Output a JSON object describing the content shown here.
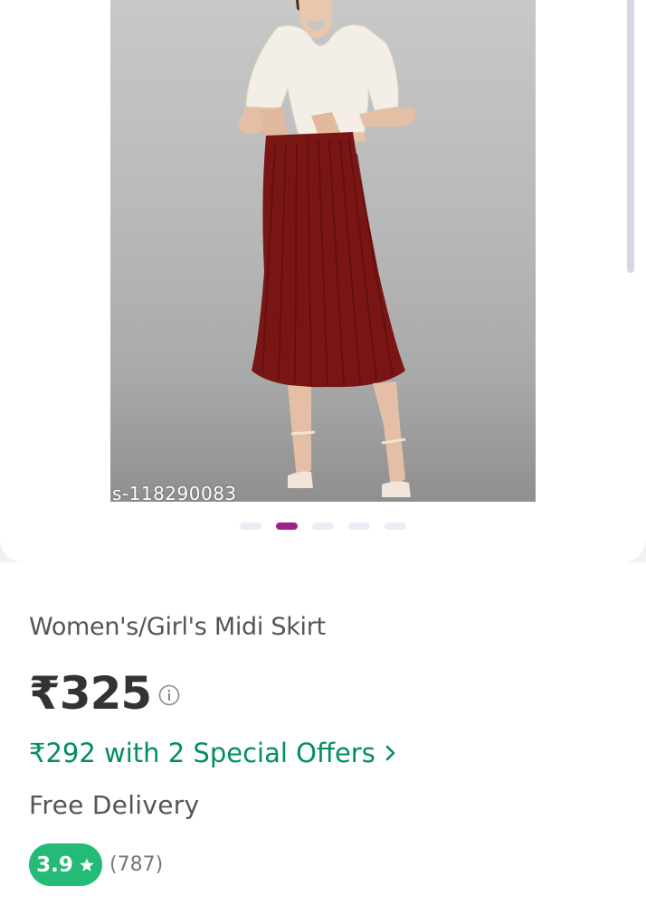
{
  "gallery": {
    "image_code": "s-118290083",
    "dots_total": 5,
    "active_dot": 2,
    "scroll_position": 0
  },
  "product": {
    "title": "Women's/Girl's Midi Skirt",
    "price": "₹325",
    "offer_text": "₹292 with 2 Special Offers",
    "delivery": "Free Delivery",
    "rating": "3.9",
    "rating_count": "(787)"
  },
  "icons": {
    "info": "info-icon",
    "chevron": "chevron-right-icon",
    "star": "star-icon"
  },
  "colors": {
    "accent": "#9f2089",
    "offer_green": "#038d63",
    "rating_green": "#23bb75",
    "skirt": "#7a1515"
  }
}
